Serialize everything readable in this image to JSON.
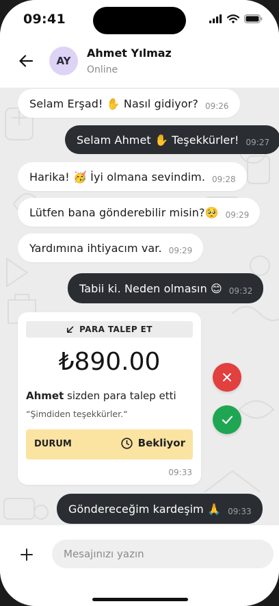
{
  "status_bar": {
    "time": "09:41"
  },
  "header": {
    "back_icon": "arrow-left-icon",
    "avatar_initials": "AY",
    "name": "Ahmet Yılmaz",
    "status": "Online"
  },
  "messages": [
    {
      "text": "Selam Erşad! ✋ Nasıl gidiyor?",
      "time": "09:26",
      "direction": "in"
    },
    {
      "text": "Selam Ahmet ✋ Teşekkürler!",
      "time": "09:27",
      "direction": "out"
    },
    {
      "text": "Harika! 🥳 İyi olmana sevindim.",
      "time": "09:28",
      "direction": "in"
    },
    {
      "text": "Lütfen bana gönderebilir misin?🥺",
      "time": "09:29",
      "direction": "in"
    },
    {
      "text": "Yardımına ihtiyacım var.",
      "time": "09:29",
      "direction": "in"
    },
    {
      "text": "Tabii ki. Neden olmasın 😊",
      "time": "09:32",
      "direction": "out"
    },
    {
      "text": "Göndereceğim kardeşim 🙏",
      "time": "09:33",
      "direction": "out"
    }
  ],
  "request_card": {
    "label": "PARA TALEP ET",
    "label_icon": "arrow-down-left-icon",
    "amount": "₺890.00",
    "requester": "Ahmet",
    "request_text": "sizden para talep etti",
    "note": "“Şimdiden teşekkürler.“",
    "status_label": "DURUM",
    "status_value": "Bekliyor",
    "status_icon": "clock-icon",
    "time": "09:33"
  },
  "actions": {
    "reject_icon": "close-icon",
    "accept_icon": "check-icon"
  },
  "composer": {
    "plus_icon": "plus-icon",
    "placeholder": "Mesajınızı yazın"
  },
  "colors": {
    "outgoing_bubble": "#2a2e33",
    "incoming_bubble": "#ffffff",
    "reject": "#e23f3f",
    "accept": "#1fa653",
    "status_bg": "#fbe3a2",
    "avatar_bg": "#ddd3f5"
  }
}
